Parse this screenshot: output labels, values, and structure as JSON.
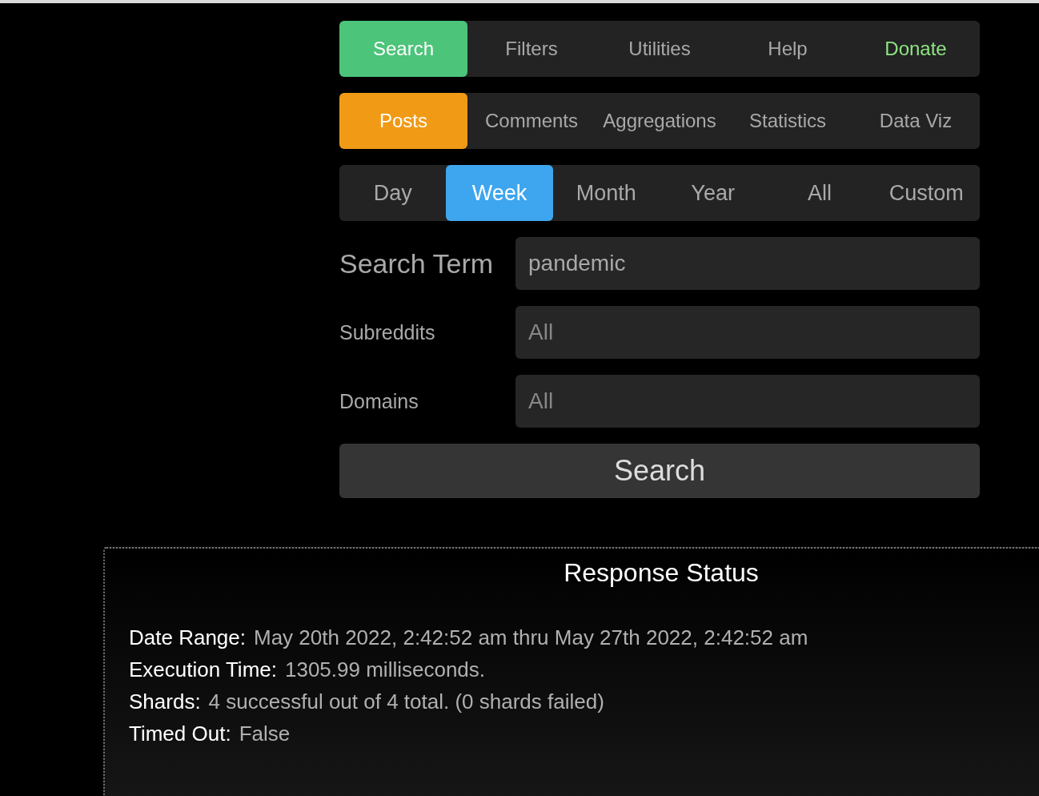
{
  "nav_tabs": [
    {
      "label": "Search",
      "selected": true,
      "highlight": false
    },
    {
      "label": "Filters",
      "selected": false,
      "highlight": false
    },
    {
      "label": "Utilities",
      "selected": false,
      "highlight": false
    },
    {
      "label": "Help",
      "selected": false,
      "highlight": false
    },
    {
      "label": "Donate",
      "selected": false,
      "highlight": true
    }
  ],
  "type_tabs": [
    {
      "label": "Posts",
      "selected": true
    },
    {
      "label": "Comments",
      "selected": false
    },
    {
      "label": "Aggregations",
      "selected": false
    },
    {
      "label": "Statistics",
      "selected": false
    },
    {
      "label": "Data Viz",
      "selected": false
    }
  ],
  "range_tabs": [
    {
      "label": "Day",
      "selected": false
    },
    {
      "label": "Week",
      "selected": true
    },
    {
      "label": "Month",
      "selected": false
    },
    {
      "label": "Year",
      "selected": false
    },
    {
      "label": "All",
      "selected": false
    },
    {
      "label": "Custom",
      "selected": false
    }
  ],
  "fields": [
    {
      "label": "Search Term",
      "value": "pandemic",
      "emphasis": true
    },
    {
      "label": "Subreddits",
      "placeholder": "All",
      "emphasis": false
    },
    {
      "label": "Domains",
      "placeholder": "All",
      "emphasis": false
    }
  ],
  "search_button": "Search",
  "response_status": {
    "title": "Response Status",
    "rows": [
      {
        "label": "Date Range:",
        "value": "May 20th 2022, 2:42:52 am thru May 27th 2022, 2:42:52 am"
      },
      {
        "label": "Execution Time:",
        "value": "1305.99 milliseconds."
      },
      {
        "label": "Shards:",
        "value": "4 successful out of 4 total. (0 shards failed)"
      },
      {
        "label": "Timed Out:",
        "value": "False"
      }
    ]
  }
}
